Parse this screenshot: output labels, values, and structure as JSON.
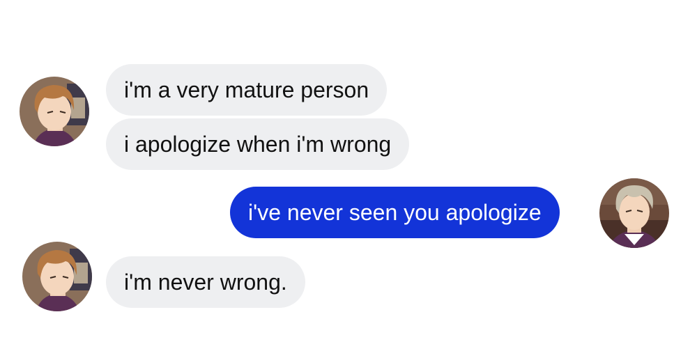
{
  "conversation": {
    "messages": [
      {
        "sender": "other",
        "text": "i'm a very mature person"
      },
      {
        "sender": "other",
        "text": "i apologize when i'm wrong"
      },
      {
        "sender": "me",
        "text": "i've never seen you apologize"
      },
      {
        "sender": "other",
        "text": "i'm never wrong."
      }
    ],
    "avatars": {
      "other": "brown-haired-character-avatar",
      "me": "silver-haired-character-avatar"
    }
  },
  "colors": {
    "incoming_bubble": "#eeeff1",
    "outgoing_bubble": "#1334d8",
    "incoming_text": "#111111",
    "outgoing_text": "#ffffff",
    "background": "#ffffff"
  }
}
